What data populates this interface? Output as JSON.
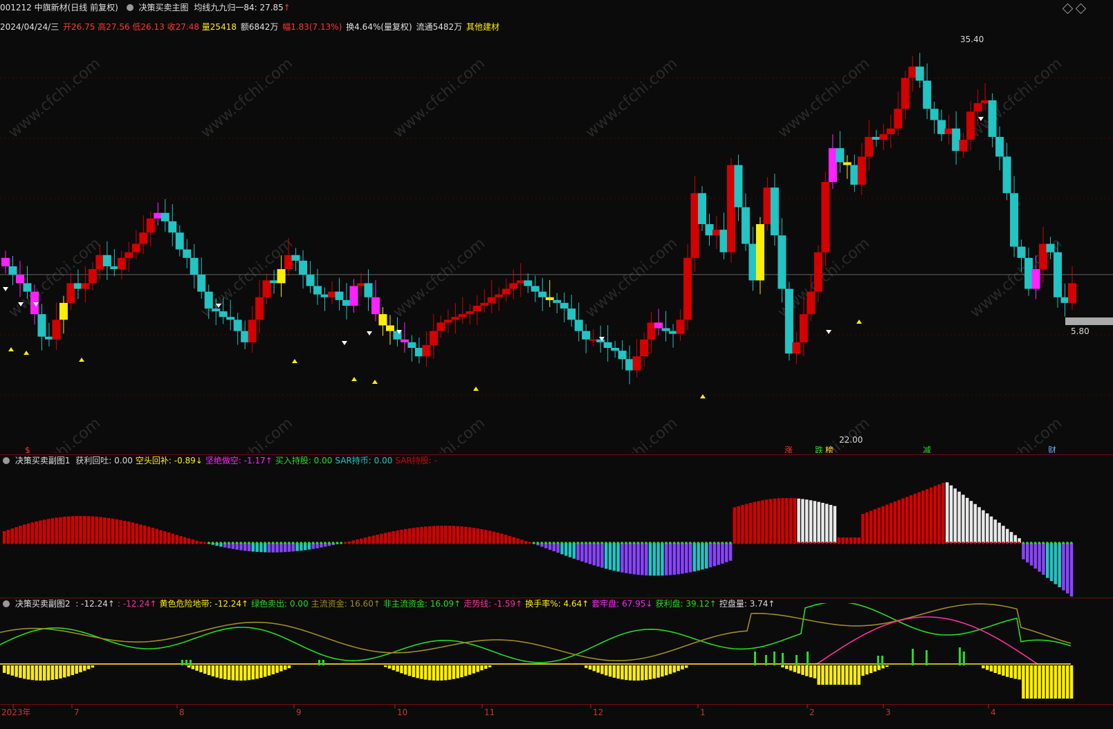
{
  "colors": {
    "up": "#d50000",
    "down": "#22c4c4",
    "magenta": "#ff22ff",
    "yellow": "#ffee00",
    "grid": "#5a0000",
    "purple": "#8844ff",
    "white": "#e8e8e8",
    "green": "#22dd22",
    "olive": "#a08c20",
    "pink": "#ff2d9a"
  },
  "header": {
    "symbol": "001212 中旗新材(日线 前复权)",
    "main_chart": "决策买卖主图",
    "ma_label": "均线九九归一84: 27.85",
    "ma_arrow": "↑"
  },
  "quote": {
    "date": "2024/04/24/三",
    "open": "开26.75",
    "high": "高27.56",
    "low": "低26.13",
    "close": "收27.48",
    "vol": "量25418",
    "amount": "额6842万",
    "change": "幅1.83(7.13%)",
    "turnover": "换4.64%(量复权)",
    "float": "流通5482万",
    "sector": "其他建材"
  },
  "price_labels": {
    "high": "35.40",
    "low": "22.00",
    "last": "5.80"
  },
  "event_labels": {
    "e1": "$",
    "e2": "涨",
    "e3": "跌",
    "e4": "榜",
    "e5": "减",
    "e6": "财"
  },
  "sub1": {
    "title": "决策买卖副图1",
    "items": [
      {
        "text": "获利回吐: 0.00",
        "color": "#d8d8d8"
      },
      {
        "text": "空头回补: -0.89↓",
        "color": "#ffee00"
      },
      {
        "text": "坚绝做空: -1.17↑",
        "color": "#ff22ff"
      },
      {
        "text": "买入持股: 0.00",
        "color": "#22dd22"
      },
      {
        "text": "SAR持币: 0.00",
        "color": "#22c4c4"
      },
      {
        "text": "SAR持股: -",
        "color": "#d50000"
      }
    ]
  },
  "sub2": {
    "title": "决策买卖副图2",
    "items": [
      {
        "text": ": -12.24↑",
        "color": "#d8d8d8"
      },
      {
        "text": ": -12.24↑",
        "color": "#ff2d9a"
      },
      {
        "text": "黄色危险地带: -12.24↑",
        "color": "#ffee00"
      },
      {
        "text": "绿色卖出: 0.00",
        "color": "#22dd22"
      },
      {
        "text": "主流资金: 16.60↑",
        "color": "#a08c20"
      },
      {
        "text": "非主流资金: 16.09↑",
        "color": "#22dd22"
      },
      {
        "text": "走势线: -1.59↑",
        "color": "#ff2d9a"
      },
      {
        "text": "换手率%: 4.64↑",
        "color": "#ffee00"
      },
      {
        "text": "套牢盘: 67.95↓",
        "color": "#ff22ff"
      },
      {
        "text": "获利盘: 39.12↑",
        "color": "#22dd22"
      },
      {
        "text": "控盘量: 3.74↑",
        "color": "#d8d8d8"
      }
    ]
  },
  "time_axis": [
    "2023年",
    "7",
    "8",
    "9",
    "10",
    "11",
    "12",
    "1",
    "2",
    "3",
    "4"
  ],
  "watermark": "www.cfchi.com",
  "chart_data": {
    "type": "candlestick",
    "price_range": [
      22.0,
      35.4
    ],
    "closes": [
      27.9,
      27.6,
      27.3,
      27.0,
      26.2,
      25.4,
      25.3,
      26.0,
      26.6,
      27.3,
      27.1,
      27.3,
      27.8,
      28.3,
      27.9,
      27.8,
      28.2,
      28.4,
      28.7,
      29.1,
      29.6,
      29.8,
      29.5,
      29.1,
      28.5,
      28.2,
      27.6,
      27.0,
      26.4,
      26.3,
      26.1,
      26.0,
      25.6,
      25.2,
      26.0,
      26.8,
      27.4,
      27.3,
      27.8,
      28.3,
      28.1,
      27.6,
      27.2,
      26.9,
      26.8,
      27.0,
      26.7,
      26.5,
      27.2,
      27.3,
      26.8,
      26.2,
      25.8,
      25.6,
      25.3,
      25.2,
      25.0,
      24.7,
      25.1,
      25.6,
      25.9,
      26.0,
      26.1,
      26.2,
      26.3,
      26.5,
      26.6,
      26.8,
      26.9,
      27.1,
      27.3,
      27.4,
      27.2,
      27.0,
      26.8,
      26.7,
      26.6,
      26.4,
      26.0,
      25.6,
      25.3,
      25.3,
      25.2,
      25.0,
      24.9,
      24.6,
      24.2,
      24.7,
      25.3,
      25.9,
      25.7,
      25.6,
      25.5,
      26.0,
      28.2,
      30.5,
      29.4,
      29.0,
      29.2,
      28.4,
      31.5,
      30.0,
      28.7,
      27.4,
      29.4,
      30.7,
      29.0,
      27.1,
      24.8,
      25.2,
      26.2,
      27.0,
      28.4,
      30.9,
      32.1,
      31.6,
      31.5,
      30.8,
      31.8,
      32.5,
      32.4,
      32.6,
      32.8,
      33.5,
      34.6,
      35.0,
      34.5,
      33.5,
      33.1,
      32.6,
      32.8,
      32.0,
      32.4,
      33.4,
      33.7,
      33.8,
      32.5,
      31.8,
      30.5,
      28.6,
      28.2,
      27.1,
      27.8,
      28.7,
      28.4,
      26.8,
      26.6,
      27.3
    ]
  }
}
